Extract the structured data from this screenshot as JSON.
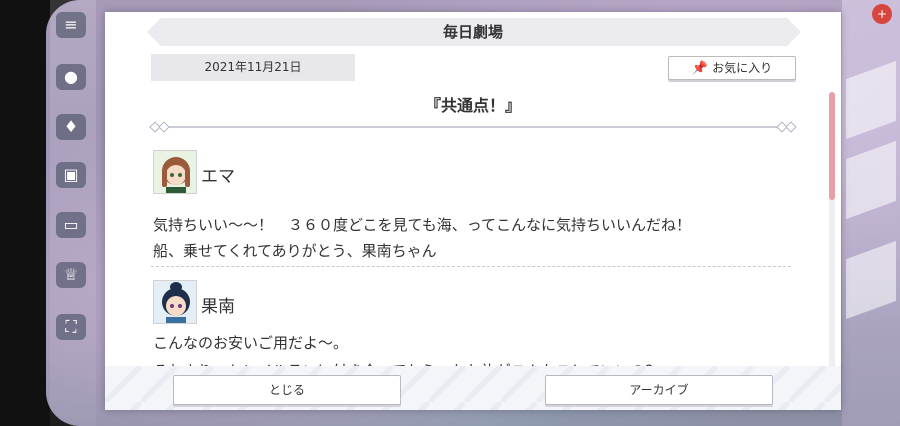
{
  "dialog": {
    "title": "毎日劇場",
    "date": "2021年11月21日",
    "favorite_label": "お気に入り",
    "story_title": "『共通点！』",
    "lines": [
      {
        "speaker": "エマ",
        "text": [
          "気持ちいい〜〜！　３６０度どこを見ても海、ってこんなに気持ちいいんだね！",
          "船、乗せてくれてありがとう、果南ちゃん"
        ]
      },
      {
        "speaker": "果南",
        "text": [
          "こんなのお安いご用だよ〜。",
          "それより、トレイルランに付き合ってもらったお礼がこんなことでいいの？"
        ]
      }
    ],
    "close_label": "とじる",
    "archive_label": "アーカイブ",
    "scroll_position": 0.0
  },
  "colors": {
    "accent_scroll": "#e79ea6",
    "title_bar": "#ebebef",
    "date_box": "#e7e7ec"
  },
  "icons": [
    "menu-icon",
    "chat-icon",
    "costume-icon",
    "gift-icon",
    "tv-icon",
    "trophy-icon",
    "fullscreen-icon",
    "pin-icon"
  ]
}
